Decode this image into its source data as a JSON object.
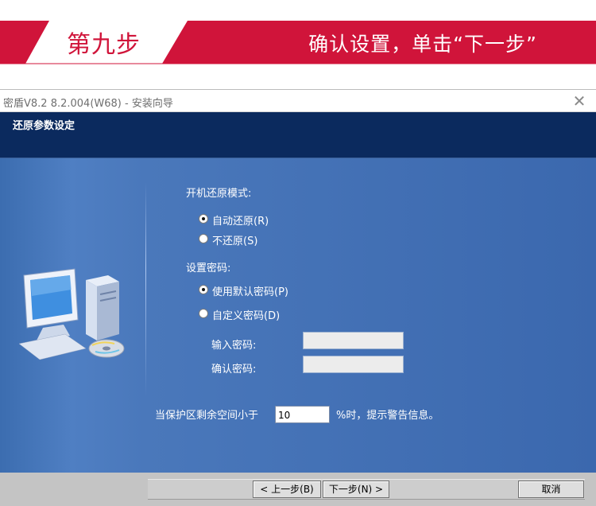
{
  "banner": {
    "step_title": "第九步",
    "step_desc": "确认设置，单击“下一步”",
    "accent_color": "#d0143a"
  },
  "window": {
    "title": "密盾V8.2 8.2.004(W68) - 安装向导",
    "close_icon": "close-icon",
    "header_title": "还原参数设定",
    "restore_mode": {
      "label": "开机还原模式:",
      "options": [
        {
          "label": "自动还原(R)",
          "selected": true
        },
        {
          "label": "不还原(S)",
          "selected": false
        }
      ]
    },
    "password": {
      "label": "设置密码:",
      "options": [
        {
          "label": "使用默认密码(P)",
          "selected": true
        },
        {
          "label": "自定义密码(D)",
          "selected": false
        }
      ],
      "input_label": "输入密码:",
      "input_value": "",
      "confirm_label": "确认密码:",
      "confirm_value": ""
    },
    "space_warning": {
      "prefix": "当保护区剩余空间小于",
      "value": "10",
      "suffix": "%时，提示警告信息。"
    },
    "buttons": {
      "back": "< 上一步(B)",
      "next": "下一步(N) >",
      "cancel": "取消"
    }
  }
}
